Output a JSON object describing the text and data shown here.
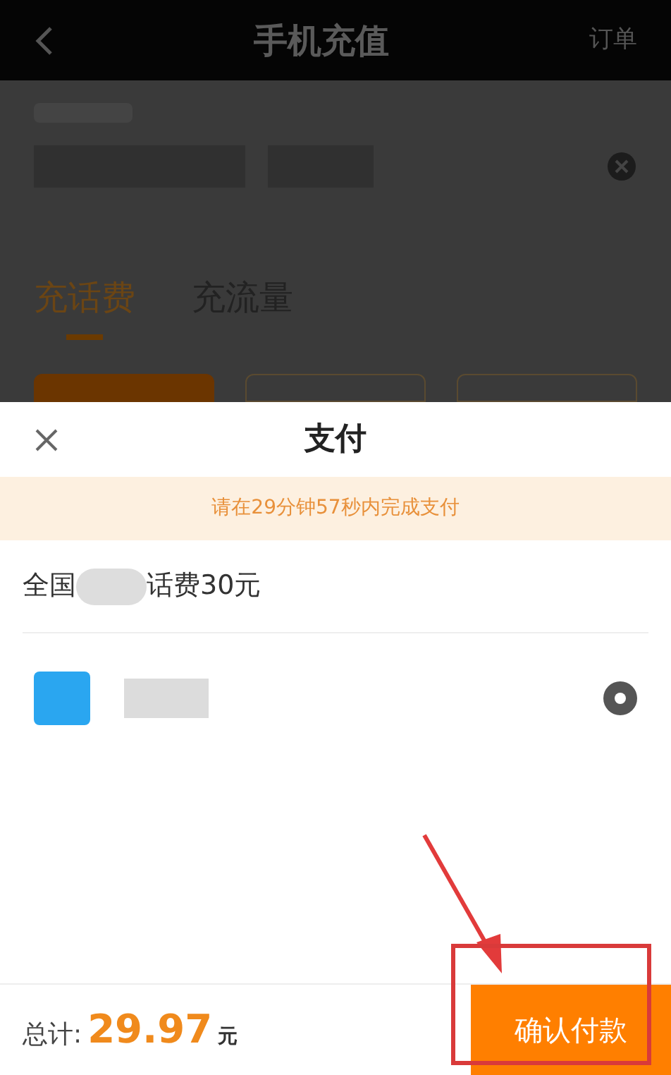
{
  "header": {
    "title": "手机充值",
    "action": "订单"
  },
  "tabs": [
    {
      "label": "充话费",
      "selected": true
    },
    {
      "label": "充流量",
      "selected": false
    }
  ],
  "amount_cards": [
    {
      "selected": true
    },
    {
      "selected": false
    },
    {
      "selected": false
    }
  ],
  "payment_sheet": {
    "title": "支付",
    "notice": "请在29分钟57秒内完成支付",
    "product": {
      "prefix": "全国",
      "suffix": "话费30元"
    },
    "methods": [
      {
        "selected": true
      }
    ],
    "total_label": "总计:",
    "total_amount": "29.97",
    "currency": "元",
    "confirm_button": "确认付款"
  }
}
